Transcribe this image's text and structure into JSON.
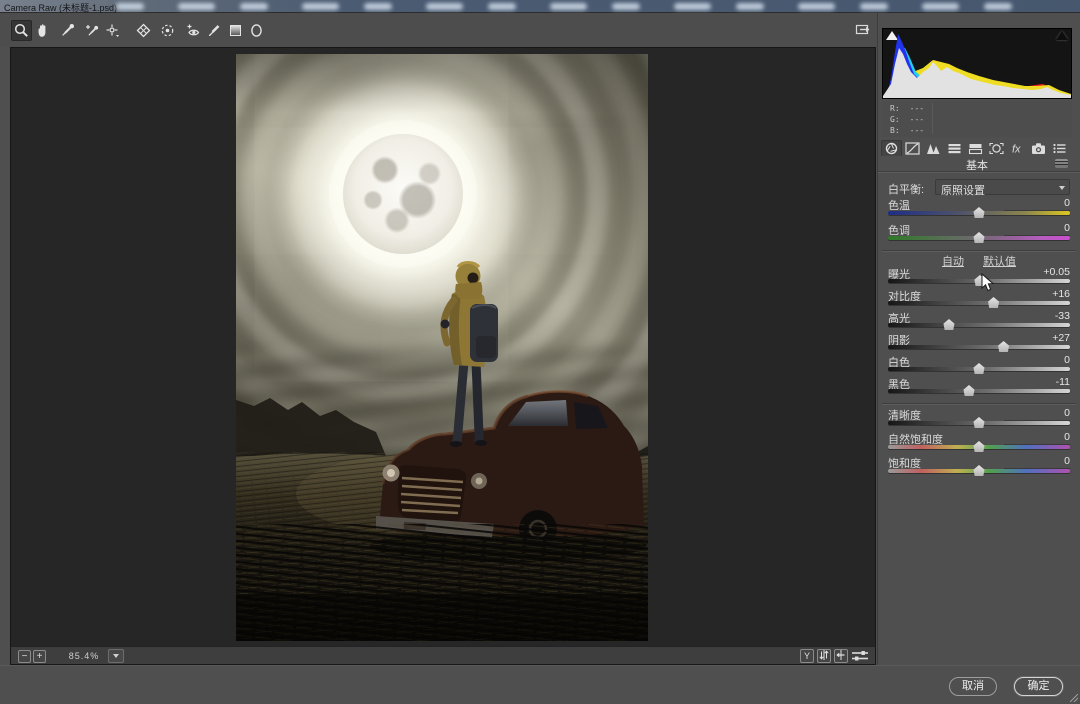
{
  "window": {
    "title": "Camera Raw (未标题-1.psd)"
  },
  "toolbar": {
    "tools": [
      {
        "name": "zoom-tool",
        "selected": true
      },
      {
        "name": "hand-tool",
        "selected": false
      },
      {
        "name": "white-balance-tool",
        "selected": false
      },
      {
        "name": "color-sampler-tool",
        "selected": false
      },
      {
        "name": "targeted-adjustment-tool",
        "selected": false
      },
      {
        "name": "transform-tool",
        "selected": false
      },
      {
        "name": "spot-removal-tool",
        "selected": false
      },
      {
        "name": "red-eye-removal-tool",
        "selected": false
      },
      {
        "name": "adjustment-brush-tool",
        "selected": false
      },
      {
        "name": "graduated-filter-tool",
        "selected": false
      },
      {
        "name": "radial-filter-tool",
        "selected": false
      }
    ],
    "fullscreen_toggle": "toggle-fullscreen"
  },
  "histogram": {
    "rgb_readout": [
      {
        "label": "R:",
        "value": "---"
      },
      {
        "label": "G:",
        "value": "---"
      },
      {
        "label": "B:",
        "value": "---"
      }
    ],
    "clipping_indicators": [
      "shadow-clipping",
      "highlight-clipping"
    ],
    "colors": {
      "gray": "#e2e2e2",
      "blue": "#2233ee",
      "cyan": "#22ccee",
      "magenta": "#ee22cc",
      "red": "#ee2222",
      "yellow": "#eedd22"
    },
    "draw_order": [
      "magenta",
      "red",
      "yellow",
      "cyan",
      "blue",
      "gray"
    ],
    "series": {
      "gray": [
        [
          0,
          2
        ],
        [
          8,
          14
        ],
        [
          12,
          34
        ],
        [
          16,
          50
        ],
        [
          20,
          44
        ],
        [
          24,
          34
        ],
        [
          28,
          26
        ],
        [
          34,
          20
        ],
        [
          40,
          26
        ],
        [
          46,
          30
        ],
        [
          50,
          36
        ],
        [
          54,
          32
        ],
        [
          58,
          27
        ],
        [
          64,
          31
        ],
        [
          70,
          27
        ],
        [
          76,
          25
        ],
        [
          82,
          22
        ],
        [
          88,
          19
        ],
        [
          96,
          17
        ],
        [
          104,
          15
        ],
        [
          112,
          13
        ],
        [
          120,
          12
        ],
        [
          130,
          10
        ],
        [
          140,
          9
        ],
        [
          150,
          8
        ],
        [
          158,
          9
        ],
        [
          164,
          11
        ],
        [
          170,
          8
        ],
        [
          178,
          5
        ],
        [
          188,
          3
        ]
      ],
      "blue": [
        [
          4,
          4
        ],
        [
          8,
          20
        ],
        [
          12,
          46
        ],
        [
          15,
          64
        ],
        [
          19,
          56
        ],
        [
          23,
          46
        ],
        [
          27,
          34
        ],
        [
          31,
          24
        ],
        [
          37,
          18
        ],
        [
          44,
          24
        ],
        [
          50,
          30
        ],
        [
          56,
          24
        ],
        [
          62,
          20
        ],
        [
          70,
          18
        ],
        [
          80,
          14
        ],
        [
          100,
          10
        ],
        [
          120,
          8
        ],
        [
          150,
          6
        ],
        [
          188,
          2
        ]
      ],
      "cyan": [
        [
          6,
          8
        ],
        [
          12,
          38
        ],
        [
          17,
          52
        ],
        [
          22,
          50
        ],
        [
          27,
          40
        ],
        [
          33,
          26
        ],
        [
          40,
          20
        ],
        [
          48,
          26
        ],
        [
          56,
          22
        ],
        [
          70,
          16
        ],
        [
          90,
          10
        ],
        [
          120,
          6
        ],
        [
          188,
          2
        ]
      ],
      "magenta": [
        [
          36,
          12
        ],
        [
          42,
          24
        ],
        [
          47,
          36
        ],
        [
          52,
          38
        ],
        [
          58,
          28
        ],
        [
          64,
          22
        ],
        [
          72,
          18
        ],
        [
          90,
          12
        ],
        [
          110,
          8
        ],
        [
          140,
          5
        ],
        [
          188,
          2
        ]
      ],
      "red": [
        [
          14,
          10
        ],
        [
          20,
          20
        ],
        [
          30,
          22
        ],
        [
          40,
          28
        ],
        [
          50,
          34
        ],
        [
          58,
          36
        ],
        [
          66,
          32
        ],
        [
          74,
          28
        ],
        [
          84,
          22
        ],
        [
          100,
          18
        ],
        [
          120,
          14
        ],
        [
          140,
          11
        ],
        [
          152,
          13
        ],
        [
          160,
          14
        ],
        [
          168,
          10
        ],
        [
          178,
          6
        ],
        [
          188,
          3
        ]
      ],
      "yellow": [
        [
          20,
          14
        ],
        [
          30,
          26
        ],
        [
          40,
          30
        ],
        [
          50,
          38
        ],
        [
          58,
          36
        ],
        [
          66,
          34
        ],
        [
          74,
          30
        ],
        [
          84,
          26
        ],
        [
          96,
          22
        ],
        [
          110,
          18
        ],
        [
          126,
          15
        ],
        [
          142,
          12
        ],
        [
          154,
          12
        ],
        [
          166,
          13
        ],
        [
          176,
          8
        ],
        [
          188,
          4
        ]
      ]
    }
  },
  "panel": {
    "tabs": [
      {
        "name": "tab-basic",
        "selected": true
      },
      {
        "name": "tab-tone-curve",
        "selected": false
      },
      {
        "name": "tab-detail",
        "selected": false
      },
      {
        "name": "tab-hsl-grayscale",
        "selected": false
      },
      {
        "name": "tab-split-toning",
        "selected": false
      },
      {
        "name": "tab-lens-corrections",
        "selected": false
      },
      {
        "name": "tab-effects",
        "selected": false,
        "glyph_text": "fx"
      },
      {
        "name": "tab-camera-calibration",
        "selected": false
      },
      {
        "name": "tab-presets",
        "selected": false
      }
    ],
    "header": "基本",
    "white_balance": {
      "label": "白平衡:",
      "value": "原照设置"
    },
    "links": {
      "auto": "自动",
      "default": "默认值"
    },
    "slider_groups": [
      [
        {
          "label": "色温",
          "value": "0",
          "track": "temp",
          "pos": 50,
          "focused": false
        },
        {
          "label": "色调",
          "value": "0",
          "track": "tint",
          "pos": 50,
          "focused": false
        }
      ],
      [
        {
          "label": "曝光",
          "value": "+0.05",
          "track": "tone",
          "pos": 50.5,
          "focused": false
        },
        {
          "label": "对比度",
          "value": "+16",
          "track": "tone",
          "pos": 58,
          "focused": false
        },
        {
          "label": "高光",
          "value": "-33",
          "track": "tone",
          "pos": 33.5,
          "focused": false
        },
        {
          "label": "阴影",
          "value": "+27",
          "track": "tone",
          "pos": 63.5,
          "focused": false
        },
        {
          "label": "白色",
          "value": "0",
          "track": "tone",
          "pos": 50,
          "focused": false
        },
        {
          "label": "黑色",
          "value": "-11",
          "track": "tone",
          "pos": 44.5,
          "focused": true
        }
      ],
      [
        {
          "label": "清晰度",
          "value": "0",
          "track": "tone",
          "pos": 50,
          "focused": false
        },
        {
          "label": "自然饱和度",
          "value": "0",
          "track": "sat",
          "pos": 50,
          "focused": false
        },
        {
          "label": "饱和度",
          "value": "0",
          "track": "sat",
          "pos": 50,
          "focused": false
        }
      ]
    ]
  },
  "statusbar": {
    "zoom_out": "−",
    "zoom_in": "+",
    "zoom_level": "85.4%",
    "preview_toggle": "Y"
  },
  "footer": {
    "cancel": "取消",
    "ok": "确定"
  },
  "colors": {
    "dialog_bg": "#4f4f4f",
    "preview_bg": "#262626",
    "accent_focus": "#3f7fd6",
    "menubar_bg": "#47586f"
  }
}
